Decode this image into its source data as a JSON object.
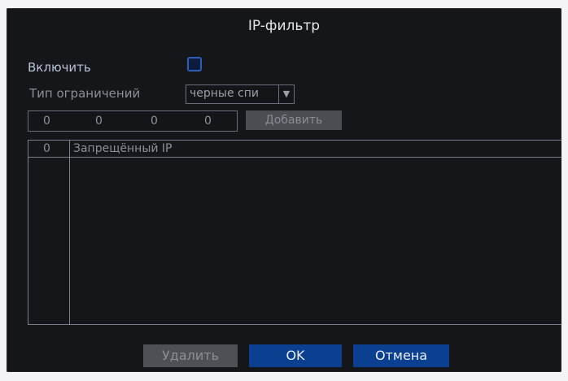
{
  "dialog": {
    "title": "IP-фильтр",
    "enable_label": "Включить",
    "enable_checked": false,
    "restriction_type_label": "Тип ограничений",
    "restriction_type_value": "черные спи",
    "ip_octets": [
      "0",
      "0",
      "0",
      "0"
    ],
    "add_button": "Добавить",
    "table": {
      "columns": [
        "0",
        "Запрещённый IP"
      ],
      "rows": []
    },
    "delete_button": "Удалить",
    "ok_button": "OK",
    "cancel_button": "Отмена"
  },
  "colors": {
    "panel_bg": "#151619",
    "accent_blue": "#0b3f8f",
    "disabled_gray": "#4e5056"
  }
}
